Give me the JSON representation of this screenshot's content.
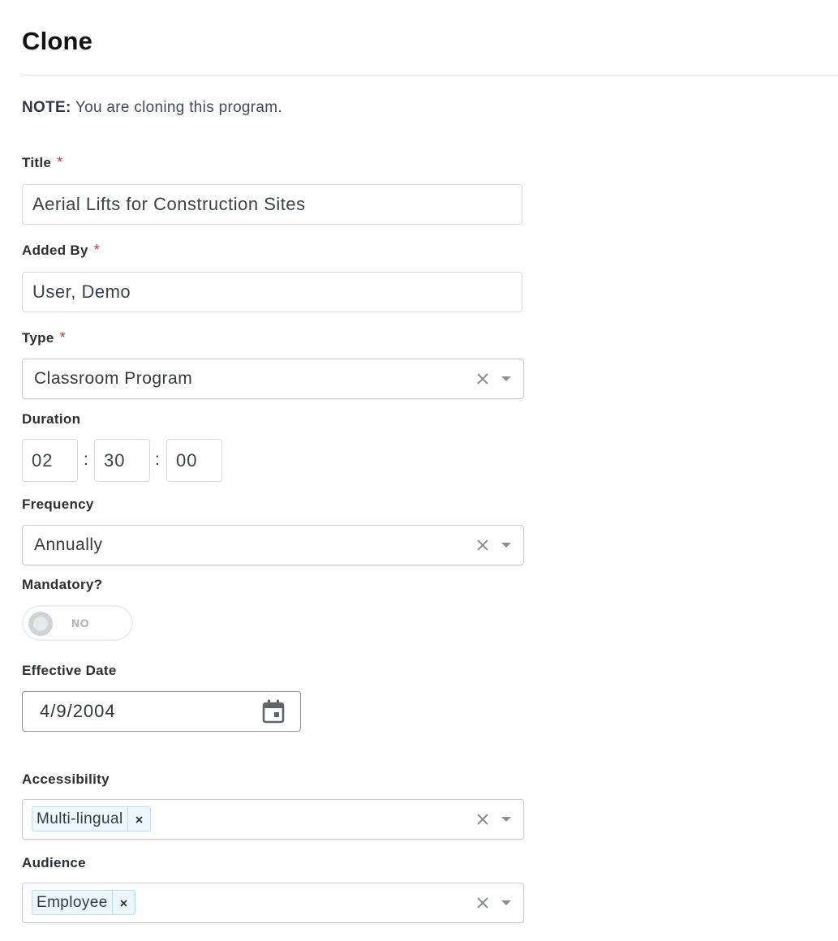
{
  "page": {
    "title": "Clone",
    "note_prefix": "NOTE:",
    "note_text": "You are cloning this program."
  },
  "fields": {
    "title": {
      "label": "Title",
      "required_mark": "*",
      "value": "Aerial Lifts for Construction Sites"
    },
    "added_by": {
      "label": "Added By",
      "required_mark": "*",
      "value": "User, Demo"
    },
    "type": {
      "label": "Type",
      "required_mark": "*",
      "value": "Classroom Program"
    },
    "duration": {
      "label": "Duration",
      "hours": "02",
      "minutes": "30",
      "seconds": "00",
      "separator": ":"
    },
    "frequency": {
      "label": "Frequency",
      "value": "Annually"
    },
    "mandatory": {
      "label": "Mandatory?",
      "toggle_text": "NO",
      "checked": false
    },
    "effective_date": {
      "label": "Effective Date",
      "value": "4/9/2004"
    },
    "accessibility": {
      "label": "Accessibility",
      "tags": [
        "Multi-lingual"
      ]
    },
    "audience": {
      "label": "Audience",
      "tags": [
        "Employee"
      ]
    }
  },
  "icons": {
    "clear": "close-icon",
    "dropdown": "chevron-down-icon",
    "calendar": "calendar-icon",
    "tag_remove": "close-icon"
  },
  "colors": {
    "required": "#d0362f",
    "tag_border": "#bcdcf5",
    "tag_background": "#eef7fe",
    "toggle_off": "#d0d3d6"
  }
}
